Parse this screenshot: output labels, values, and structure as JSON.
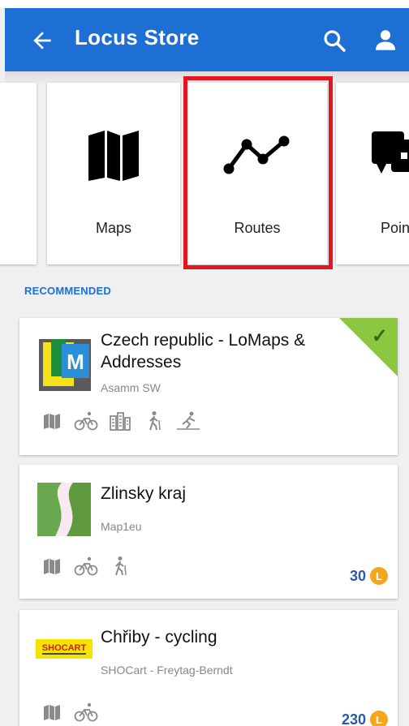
{
  "header": {
    "title": "Locus Store",
    "back_icon": "arrow-back-icon",
    "search_icon": "search-icon",
    "account_icon": "account-icon",
    "color": "#1d6fd3"
  },
  "categories": [
    {
      "label": "",
      "icon": "unknown-icon"
    },
    {
      "label": "Maps",
      "icon": "map-icon"
    },
    {
      "label": "Routes",
      "icon": "route-icon",
      "highlighted": true,
      "highlight_color": "#e3161f"
    },
    {
      "label": "Poin",
      "icon": "points-icon"
    }
  ],
  "section": {
    "label": "RECOMMENDED"
  },
  "items": [
    {
      "title": "Czech republic - LoMaps & Addresses",
      "author": "Asamm SW",
      "activities": [
        "map-icon",
        "cycling-icon",
        "buildings-icon",
        "hiking-icon",
        "ski-icon"
      ],
      "owned": true,
      "price": ""
    },
    {
      "title": "Zlinsky kraj",
      "author": "Map1eu",
      "activities": [
        "map-icon",
        "cycling-icon",
        "hiking-icon"
      ],
      "owned": false,
      "price": "30"
    },
    {
      "title": "Chřiby - cycling",
      "author": "SHOCart - Freytag-Berndt",
      "logo_text": "SHOCART",
      "activities": [
        "map-icon",
        "cycling-icon"
      ],
      "owned": false,
      "price": "230"
    }
  ],
  "coin_symbol": "L",
  "owned_check": "✓"
}
